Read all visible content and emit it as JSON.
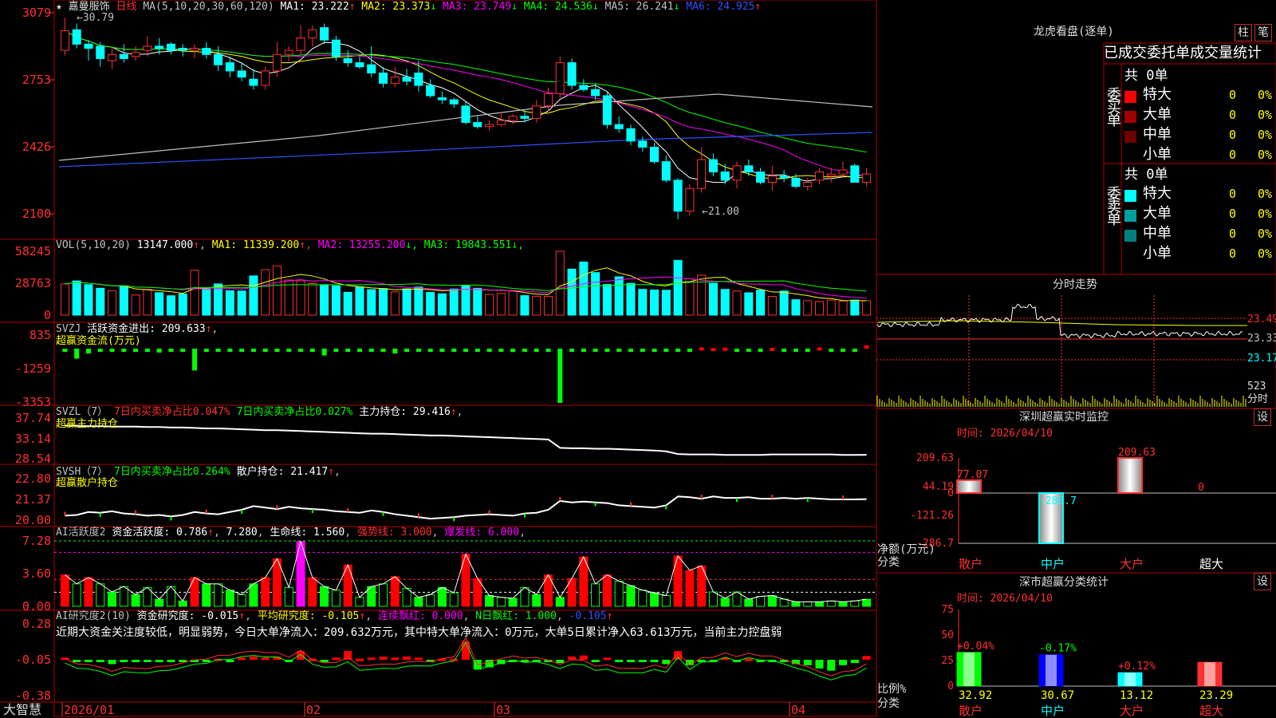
{
  "app": {
    "brand": "大智慧"
  },
  "stock": {
    "name": "嘉曼服饰",
    "period": "日线",
    "high_mark": "30.79",
    "low_mark": "21.00"
  },
  "main_pane": {
    "ma_params": "MA(5,10,20,30,60,120)",
    "items": [
      {
        "label": "MA1:",
        "value": "23.222",
        "dir": "↑",
        "color": "#ffffff"
      },
      {
        "label": "MA2:",
        "value": "23.373",
        "dir": "↓",
        "color": "#ffff00"
      },
      {
        "label": "MA3:",
        "value": "23.749",
        "dir": "↓",
        "color": "#ff00ff"
      },
      {
        "label": "MA4:",
        "value": "24.536",
        "dir": "↓",
        "color": "#00ff00"
      },
      {
        "label": "MA5:",
        "value": "26.241",
        "dir": "↓",
        "color": "#c0c0c0"
      },
      {
        "label": "MA6:",
        "value": "24.925",
        "dir": "↑",
        "color": "#3050ff"
      }
    ],
    "y_ticks": [
      "3079",
      "2753",
      "2426",
      "2100"
    ]
  },
  "vol_pane": {
    "title": "VOL(5,10,20)",
    "value": "13147.000",
    "value_dir": "↑",
    "items": [
      {
        "label": "MA1:",
        "value": "11339.200",
        "dir": "↑",
        "color": "#ffff00"
      },
      {
        "label": "MA2:",
        "value": "13255.200",
        "dir": "↓",
        "color": "#ff00ff"
      },
      {
        "label": "MA3:",
        "value": "19843.551",
        "dir": "↓",
        "color": "#00ff00"
      }
    ],
    "y_ticks": [
      "58245",
      "28763",
      "0"
    ]
  },
  "svzj_pane": {
    "title": "SVZJ",
    "text": "活跃资金进出:",
    "value": "209.633",
    "dir": "↑",
    "sub": "超赢资金流(万元)",
    "y_ticks": [
      "835",
      "-1259",
      "-3353"
    ]
  },
  "svzl_pane": {
    "title": "SVZL（7）",
    "red_text": "7日内买卖净占比0.047%",
    "green_text": "7日内买卖净占比0.027%",
    "label": "主力持仓:",
    "value": "29.416",
    "dir": "↑",
    "sub": "超赢主力持仓",
    "y_ticks": [
      "37.74",
      "33.14",
      "28.54"
    ]
  },
  "svsh_pane": {
    "title": "SVSH（7）",
    "green_text": "7日内买卖净占比0.264%",
    "label": "散户持仓:",
    "value": "21.417",
    "dir": "↑",
    "sub": "超赢散户持仓",
    "y_ticks": [
      "22.80",
      "21.37",
      "20.00"
    ]
  },
  "ai_active": {
    "title": "AI活跃度2",
    "label": "资金活跃度:",
    "value": "0.786",
    "v2": "7.280",
    "life_label": "生命线:",
    "life_value": "1.560",
    "strong_label": "强势线:",
    "strong_value": "3.000",
    "burst_label": "爆发线:",
    "burst_value": "6.000",
    "y_ticks": [
      "7.28",
      "3.60",
      "0.00"
    ]
  },
  "ai_research": {
    "title": "AI研究度2(10)",
    "label": "资金研究度:",
    "value": "-0.015",
    "avg_label": "平均研究度:",
    "avg_value": "-0.105",
    "cont_label": "连续飘红:",
    "cont_value": "0.000",
    "n_label": "N日飘红:",
    "n_value": "1.000",
    "last_value": "-0.105",
    "note": "近期大资金关注度较低，明显弱势，今日大单净流入：209.632万元，其中特大单净流入：0万元，大单5日累计净入63.613万元，当前主力控盘弱",
    "y_ticks": [
      "0.28",
      "-0.05",
      "-0.38"
    ]
  },
  "x_axis": [
    "2026/01",
    "02",
    "03",
    "04"
  ],
  "dragon": {
    "title": "龙虎看盘(逐单)",
    "btn_zhu": "柱",
    "btn_bi": "笔",
    "header": "已成交委托单成交量统计",
    "buy": {
      "side": "委买单",
      "count": "共 0单",
      "rows": [
        {
          "name": "特大",
          "value": "0",
          "pct": "0%",
          "color": "#ff0000"
        },
        {
          "name": "大单",
          "value": "0",
          "pct": "0%",
          "color": "#a00000"
        },
        {
          "name": "中单",
          "value": "0",
          "pct": "0%",
          "color": "#700000"
        },
        {
          "name": "小单",
          "value": "0",
          "pct": "0%",
          "color": "#000000"
        }
      ]
    },
    "sell": {
      "side": "委卖单",
      "count": "共 0单",
      "rows": [
        {
          "name": "特大",
          "value": "0",
          "pct": "0%",
          "color": "#00ffff"
        },
        {
          "name": "大单",
          "value": "0",
          "pct": "0%",
          "color": "#00a0a0"
        },
        {
          "name": "中单",
          "value": "0",
          "pct": "0%",
          "color": "#008080"
        },
        {
          "name": "小单",
          "value": "0",
          "pct": "0%",
          "color": "#000000"
        }
      ]
    }
  },
  "intraday": {
    "title": "分时走势",
    "prices": [
      "23.49",
      "23.33",
      "23.17"
    ],
    "vol": "523",
    "vol_label": "分时"
  },
  "sz_monitor": {
    "title": "深圳超赢实时监控",
    "set": "设",
    "time": "时间: 2026/04/10",
    "y_ticks": [
      "209.63",
      "44.19",
      "0",
      "-121.26",
      "-286.7"
    ],
    "ylabel": "净额(万元)",
    "cat_label": "分类",
    "bars": [
      {
        "name": "散户",
        "value": 77.07,
        "label": "77.07"
      },
      {
        "name": "中户",
        "value": -286.7,
        "label": "-286.7"
      },
      {
        "name": "大户",
        "value": 209.63,
        "label": "209.63"
      },
      {
        "name": "超大",
        "value": 0,
        "label": "0"
      }
    ]
  },
  "sz_class": {
    "title": "深市超赢分类统计",
    "set": "设",
    "time": "时间: 2026/04/10",
    "y_ticks": [
      "75",
      "50",
      "25",
      "0"
    ],
    "ylabel": "比例%",
    "cat_label": "分类",
    "bars": [
      {
        "name": "散户",
        "value": 32.92,
        "label": "32.92",
        "change": "+0.04%"
      },
      {
        "name": "中户",
        "value": 30.67,
        "label": "30.67",
        "change": "-0.17%"
      },
      {
        "name": "大户",
        "value": 13.12,
        "label": "13.12",
        "change": "+0.12%"
      },
      {
        "name": "超大",
        "value": 23.29,
        "label": "23.29",
        "change": ""
      }
    ]
  },
  "chart_data": {
    "type": "candlestick",
    "x": [
      "2026/01",
      "02",
      "03",
      "04"
    ],
    "candles": [
      [
        29.2,
        30.79,
        28.95,
        30.15
      ],
      [
        30.2,
        30.5,
        29.3,
        29.5
      ],
      [
        29.5,
        29.7,
        28.7,
        29.3
      ],
      [
        29.4,
        29.6,
        28.4,
        28.8
      ],
      [
        28.7,
        29.3,
        28.3,
        29.0
      ],
      [
        29.0,
        29.5,
        28.6,
        28.8
      ],
      [
        28.9,
        29.4,
        28.7,
        29.1
      ],
      [
        29.2,
        29.9,
        28.9,
        29.4
      ],
      [
        29.4,
        29.8,
        29.0,
        29.3
      ],
      [
        29.5,
        29.6,
        29.0,
        29.2
      ],
      [
        29.3,
        29.5,
        28.9,
        29.2
      ],
      [
        29.2,
        29.5,
        28.8,
        29.3
      ],
      [
        29.3,
        29.6,
        28.8,
        29.0
      ],
      [
        29.0,
        29.4,
        28.2,
        28.5
      ],
      [
        28.6,
        28.9,
        27.9,
        28.2
      ],
      [
        28.2,
        28.6,
        27.7,
        27.9
      ],
      [
        27.8,
        28.3,
        27.3,
        27.5
      ],
      [
        27.5,
        28.4,
        27.3,
        28.2
      ],
      [
        28.2,
        29.6,
        27.9,
        29.0
      ],
      [
        29.0,
        29.4,
        28.7,
        29.2
      ],
      [
        29.2,
        30.4,
        29.0,
        29.8
      ],
      [
        29.8,
        30.4,
        29.4,
        30.2
      ],
      [
        30.3,
        30.5,
        29.5,
        29.7
      ],
      [
        29.7,
        29.9,
        28.7,
        28.9
      ],
      [
        28.8,
        29.2,
        28.4,
        28.6
      ],
      [
        28.6,
        28.9,
        28.3,
        28.4
      ],
      [
        28.5,
        29.4,
        27.9,
        28.1
      ],
      [
        28.1,
        28.4,
        27.4,
        27.6
      ],
      [
        27.6,
        28.4,
        27.4,
        27.9
      ],
      [
        27.9,
        28.3,
        27.5,
        27.7
      ],
      [
        28.1,
        28.7,
        27.2,
        27.5
      ],
      [
        27.5,
        27.8,
        26.9,
        27.0
      ],
      [
        26.9,
        27.2,
        26.6,
        26.8
      ],
      [
        26.8,
        26.9,
        26.4,
        26.6
      ],
      [
        26.5,
        26.7,
        25.6,
        25.7
      ],
      [
        25.7,
        26.0,
        25.4,
        25.5
      ],
      [
        25.5,
        25.8,
        25.3,
        25.6
      ],
      [
        25.6,
        26.2,
        25.5,
        25.8
      ],
      [
        25.8,
        26.1,
        25.6,
        26.0
      ],
      [
        26.0,
        26.3,
        25.7,
        25.9
      ],
      [
        25.9,
        26.8,
        25.7,
        26.5
      ],
      [
        26.5,
        27.4,
        26.2,
        27.1
      ],
      [
        27.1,
        28.9,
        26.9,
        28.6
      ],
      [
        28.6,
        28.8,
        27.3,
        27.5
      ],
      [
        27.5,
        27.8,
        27.2,
        27.3
      ],
      [
        27.3,
        27.6,
        26.8,
        27.0
      ],
      [
        27.0,
        27.2,
        25.4,
        25.6
      ],
      [
        25.6,
        26.0,
        25.2,
        25.4
      ],
      [
        25.4,
        25.6,
        24.6,
        24.8
      ],
      [
        24.8,
        25.0,
        24.3,
        24.5
      ],
      [
        24.5,
        24.7,
        23.7,
        23.8
      ],
      [
        23.8,
        24.1,
        22.8,
        22.9
      ],
      [
        22.9,
        23.0,
        21.0,
        21.4
      ],
      [
        21.4,
        22.7,
        21.2,
        22.5
      ],
      [
        22.5,
        24.5,
        22.3,
        23.9
      ],
      [
        23.9,
        24.2,
        23.1,
        23.3
      ],
      [
        23.3,
        23.7,
        22.7,
        22.9
      ],
      [
        22.9,
        23.8,
        22.5,
        23.6
      ],
      [
        23.6,
        23.9,
        23.1,
        23.3
      ],
      [
        23.3,
        23.5,
        22.7,
        22.8
      ],
      [
        22.8,
        23.6,
        22.4,
        23.1
      ],
      [
        23.1,
        23.4,
        22.8,
        23.0
      ],
      [
        23.0,
        23.2,
        22.5,
        22.6
      ],
      [
        22.6,
        23.0,
        22.4,
        22.8
      ],
      [
        22.9,
        23.5,
        22.7,
        23.3
      ],
      [
        23.1,
        23.5,
        22.8,
        23.2
      ],
      [
        23.2,
        23.8,
        23.0,
        23.4
      ],
      [
        23.6,
        23.7,
        22.8,
        22.8
      ],
      [
        22.8,
        23.5,
        22.6,
        23.2
      ]
    ],
    "volume": [
      28500,
      31200,
      27800,
      24500,
      22300,
      26800,
      18400,
      23500,
      20500,
      17700,
      19300,
      41000,
      24200,
      28500,
      22300,
      22000,
      35800,
      41500,
      45000,
      32000,
      31300,
      28800,
      27800,
      26700,
      20800,
      25800,
      23300,
      24300,
      21200,
      24000,
      25600,
      20800,
      19500,
      23800,
      27300,
      24500,
      18900,
      19800,
      21800,
      17800,
      17200,
      17000,
      58245,
      42000,
      48500,
      38800,
      28000,
      35000,
      29000,
      23500,
      23000,
      22700,
      50000,
      33200,
      36500,
      29100,
      23500,
      22000,
      20400,
      22800,
      17100,
      22000,
      14100,
      13200,
      12500,
      13700,
      12800,
      13800,
      13147
    ],
    "svzj": [
      -200,
      -620,
      -300,
      -150,
      -80,
      -120,
      -90,
      -60,
      -240,
      -180,
      -150,
      -1350,
      -120,
      -150,
      -110,
      -130,
      -90,
      -150,
      -200,
      -70,
      -120,
      -150,
      -420,
      -180,
      -190,
      -70,
      -150,
      -120,
      -300,
      -190,
      -100,
      -150,
      -200,
      -140,
      -60,
      -120,
      -90,
      -170,
      -210,
      -110,
      -130,
      -180,
      -3353,
      -60,
      -80,
      -70,
      -60,
      -120,
      -200,
      -140,
      -120,
      -90,
      -80,
      -110,
      80,
      40,
      60,
      -80,
      -60,
      -70,
      50,
      -90,
      -80,
      -60,
      80,
      -70,
      -60,
      -90,
      209
    ],
    "svzl": [
      36.0,
      36.0,
      35.9,
      35.9,
      35.8,
      35.8,
      35.8,
      35.7,
      35.7,
      35.6,
      35.6,
      35.5,
      35.4,
      35.4,
      35.3,
      35.2,
      35.1,
      35.0,
      35.0,
      34.9,
      34.8,
      34.7,
      34.6,
      34.5,
      34.4,
      34.3,
      34.2,
      34.2,
      34.1,
      34.0,
      33.9,
      33.8,
      33.8,
      33.7,
      33.6,
      33.5,
      33.4,
      33.3,
      33.2,
      33.1,
      33.0,
      32.9,
      31.0,
      30.9,
      30.9,
      30.8,
      30.8,
      30.7,
      30.6,
      30.5,
      30.4,
      30.2,
      29.6,
      29.5,
      29.5,
      29.5,
      29.4,
      29.4,
      29.4,
      29.4,
      29.5,
      29.5,
      29.5,
      29.5,
      29.5,
      29.5,
      29.4,
      29.4,
      29.416
    ],
    "svsh": [
      20.3,
      20.35,
      20.55,
      20.5,
      20.6,
      20.45,
      20.4,
      20.3,
      20.35,
      20.25,
      20.35,
      20.55,
      20.45,
      20.4,
      20.55,
      20.7,
      20.95,
      20.85,
      20.75,
      20.9,
      20.8,
      20.75,
      20.7,
      20.6,
      20.55,
      20.5,
      20.65,
      20.55,
      20.4,
      20.3,
      20.2,
      20.1,
      20.15,
      20.2,
      20.3,
      20.35,
      20.4,
      20.35,
      20.3,
      20.45,
      20.5,
      20.7,
      21.3,
      21.2,
      21.25,
      21.2,
      21.15,
      21.0,
      20.95,
      20.9,
      20.85,
      21.0,
      21.6,
      21.55,
      21.45,
      21.6,
      21.5,
      21.5,
      21.55,
      21.45,
      21.45,
      21.5,
      21.45,
      21.5,
      21.45,
      21.4,
      21.4,
      21.4,
      21.417
    ],
    "activity": [
      3.5,
      2.5,
      3.2,
      2.5,
      1.6,
      2.2,
      1.3,
      2.1,
      0.8,
      2.2,
      0.6,
      3.2,
      2.5,
      2.5,
      1.8,
      1.3,
      2.5,
      3.2,
      5.3,
      2.1,
      7.2,
      3.2,
      2.2,
      1.8,
      4.6,
      1.0,
      2.2,
      2.5,
      3.3,
      2.0,
      1.0,
      1.3,
      2.1,
      1.5,
      5.8,
      3.1,
      1.2,
      1.0,
      0.9,
      2.1,
      1.3,
      3.5,
      1.0,
      3.1,
      5.5,
      2.5,
      3.5,
      2.8,
      2.3,
      1.8,
      1.5,
      1.2,
      5.6,
      4.0,
      4.5,
      1.6,
      0.9,
      1.6,
      0.8,
      1.1,
      1.2,
      0.8,
      0.5,
      0.5,
      0.5,
      0.6,
      0.5,
      0.6,
      0.79
    ],
    "research": [
      -0.03,
      -0.06,
      -0.05,
      -0.06,
      -0.09,
      -0.05,
      -0.06,
      -0.07,
      -0.06,
      -0.07,
      -0.06,
      -0.05,
      -0.06,
      -0.04,
      -0.05,
      -0.03,
      -0.02,
      -0.03,
      -0.02,
      -0.05,
      0.03,
      -0.04,
      -0.05,
      -0.03,
      0.03,
      -0.04,
      -0.03,
      -0.02,
      -0.03,
      -0.02,
      -0.03,
      -0.05,
      -0.04,
      -0.04,
      0.12,
      -0.14,
      -0.12,
      -0.09,
      -0.06,
      -0.07,
      -0.05,
      -0.06,
      -0.08,
      -0.02,
      -0.01,
      -0.05,
      -0.03,
      -0.06,
      -0.06,
      -0.07,
      -0.05,
      -0.09,
      0.03,
      -0.1,
      -0.05,
      -0.06,
      -0.03,
      -0.07,
      -0.04,
      -0.06,
      -0.05,
      -0.07,
      -0.09,
      -0.1,
      -0.13,
      -0.15,
      -0.1,
      -0.08,
      -0.015
    ]
  }
}
